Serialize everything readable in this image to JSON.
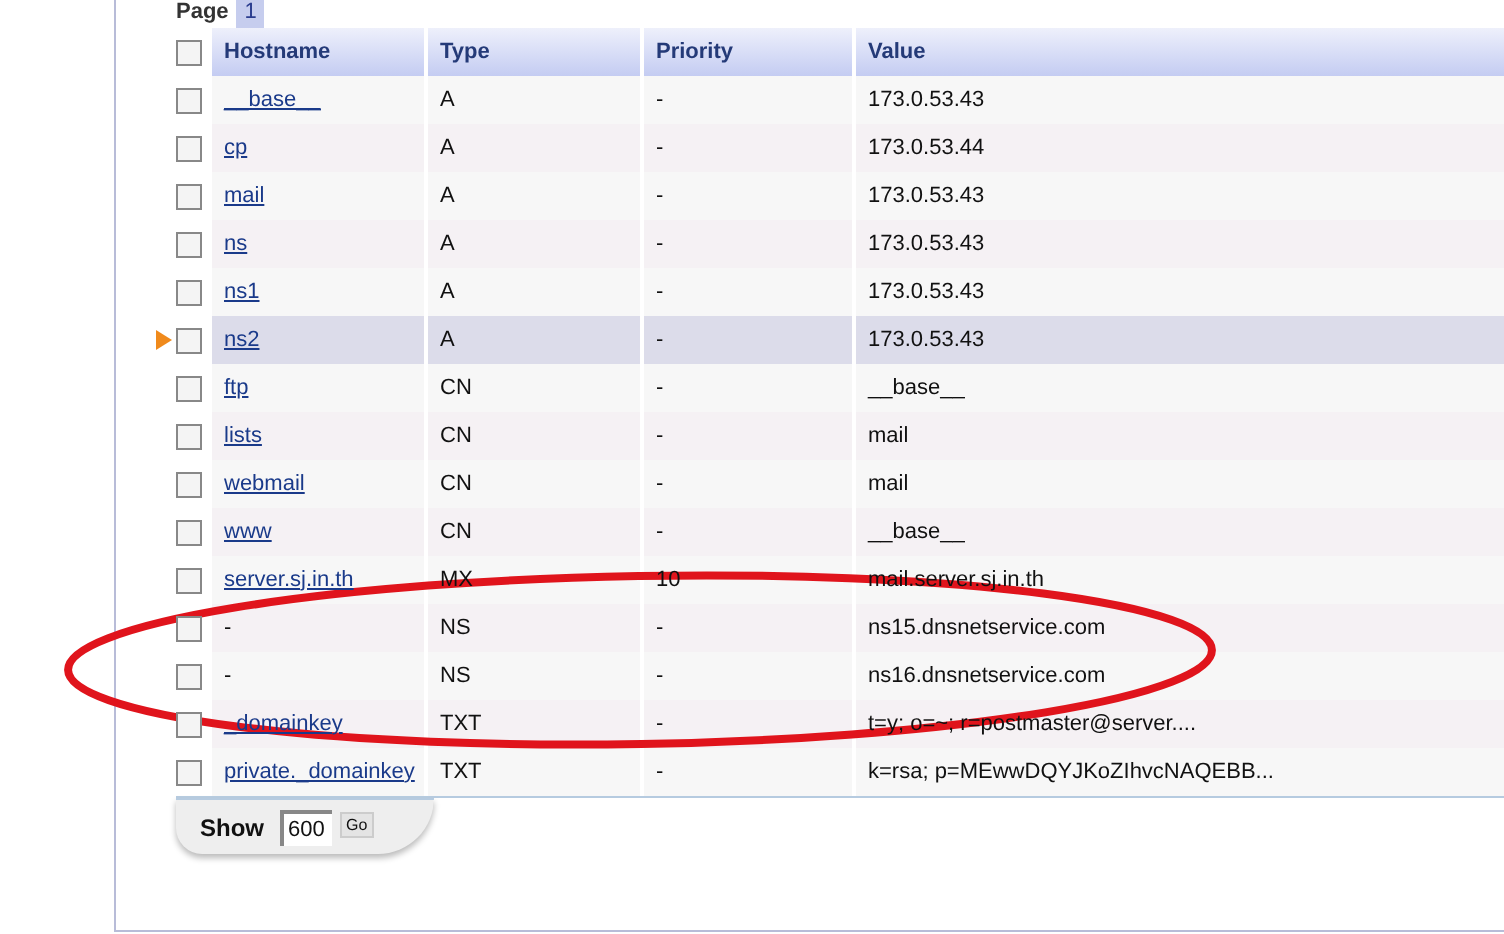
{
  "pager": {
    "label": "Page",
    "current": "1"
  },
  "table": {
    "all_checked": false,
    "columns": [
      "Hostname",
      "Type",
      "Priority",
      "Value"
    ],
    "rows": [
      {
        "hostname": "__base__",
        "link": true,
        "type": "A",
        "priority": "-",
        "value": "173.0.53.43",
        "checked": false,
        "selected": false
      },
      {
        "hostname": "cp",
        "link": true,
        "type": "A",
        "priority": "-",
        "value": "173.0.53.44",
        "checked": false,
        "selected": false
      },
      {
        "hostname": "mail",
        "link": true,
        "type": "A",
        "priority": "-",
        "value": "173.0.53.43",
        "checked": false,
        "selected": false
      },
      {
        "hostname": "ns",
        "link": true,
        "type": "A",
        "priority": "-",
        "value": "173.0.53.43",
        "checked": false,
        "selected": false
      },
      {
        "hostname": "ns1",
        "link": true,
        "type": "A",
        "priority": "-",
        "value": "173.0.53.43",
        "checked": false,
        "selected": false
      },
      {
        "hostname": "ns2",
        "link": true,
        "type": "A",
        "priority": "-",
        "value": "173.0.53.43",
        "checked": false,
        "selected": true
      },
      {
        "hostname": "ftp",
        "link": true,
        "type": "CN",
        "priority": "-",
        "value": "__base__",
        "checked": false,
        "selected": false
      },
      {
        "hostname": "lists",
        "link": true,
        "type": "CN",
        "priority": "-",
        "value": "mail",
        "checked": false,
        "selected": false
      },
      {
        "hostname": "webmail",
        "link": true,
        "type": "CN",
        "priority": "-",
        "value": "mail",
        "checked": false,
        "selected": false
      },
      {
        "hostname": "www",
        "link": true,
        "type": "CN",
        "priority": "-",
        "value": "__base__",
        "checked": false,
        "selected": false
      },
      {
        "hostname": "server.sj.in.th",
        "link": true,
        "type": "MX",
        "priority": "10",
        "value": "mail.server.sj.in.th",
        "checked": false,
        "selected": false
      },
      {
        "hostname": "-",
        "link": false,
        "type": "NS",
        "priority": "-",
        "value": "ns15.dnsnetservice.com",
        "checked": false,
        "selected": false
      },
      {
        "hostname": "-",
        "link": false,
        "type": "NS",
        "priority": "-",
        "value": "ns16.dnsnetservice.com",
        "checked": false,
        "selected": false
      },
      {
        "hostname": "_domainkey",
        "link": true,
        "type": "TXT",
        "priority": "-",
        "value": "t=y; o=~; r=postmaster@server....",
        "checked": false,
        "selected": false
      },
      {
        "hostname": "private._domainkey",
        "link": true,
        "type": "TXT",
        "priority": "-",
        "value": "k=rsa; p=MEwwDQYJKoZIhvcNAQEBB...",
        "checked": false,
        "selected": false
      }
    ]
  },
  "footer": {
    "label": "Show",
    "page_size": "600",
    "button": "Go"
  }
}
